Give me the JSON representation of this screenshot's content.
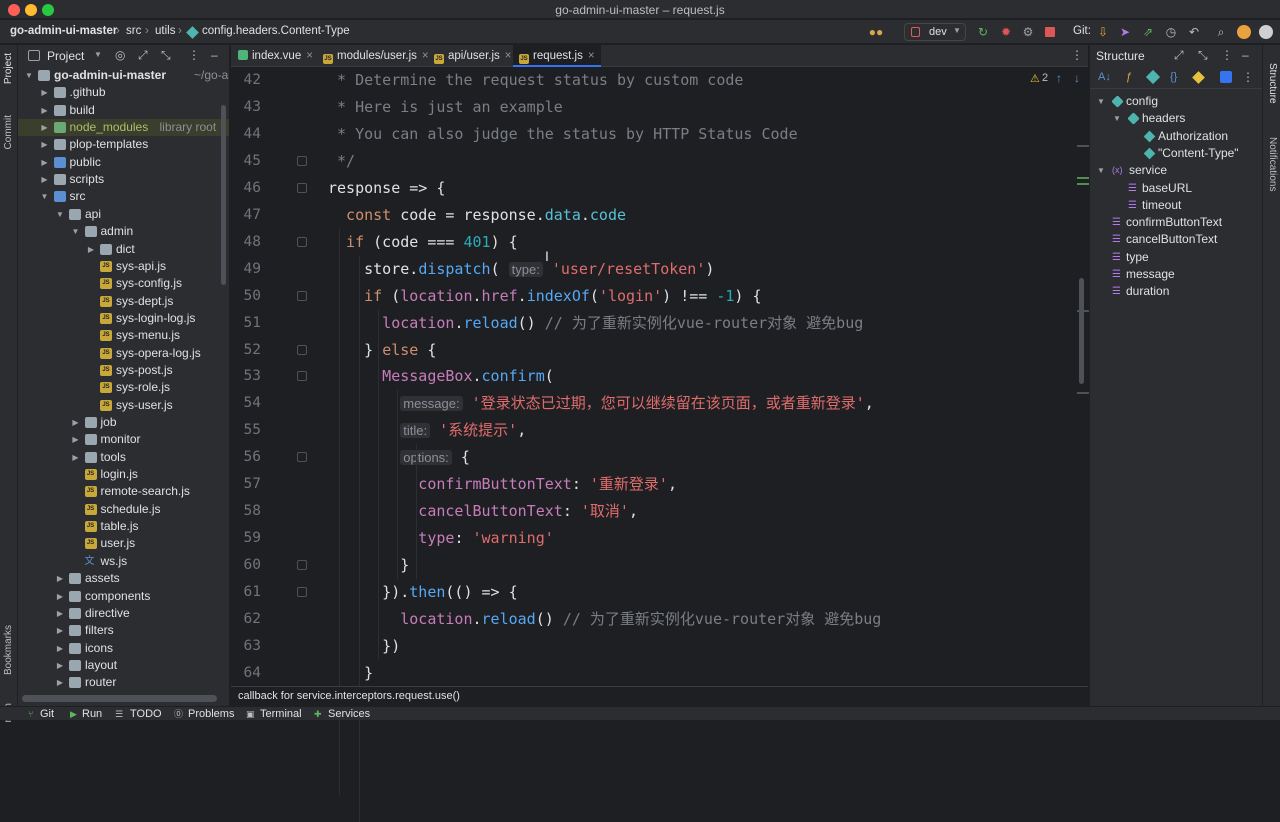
{
  "window": {
    "title": "go-admin-ui-master – request.js"
  },
  "breadcrumb": [
    "go-admin-ui-master",
    "src",
    "utils",
    "config.headers.Content-Type"
  ],
  "toolbar": {
    "branch": "dev",
    "git_label": "Git:"
  },
  "project_panel": {
    "title": "Project",
    "tree": [
      {
        "label": "go-admin-ui-master",
        "suffix": "~/go-adn",
        "depth": 0,
        "arrow": "down",
        "icon": "folder",
        "bold": true
      },
      {
        "label": ".github",
        "depth": 1,
        "arrow": "right",
        "icon": "folder"
      },
      {
        "label": "build",
        "depth": 1,
        "arrow": "right",
        "icon": "folder"
      },
      {
        "label": "node_modules",
        "suffix": "library root",
        "depth": 1,
        "arrow": "right",
        "icon": "folder-green",
        "highlight": true
      },
      {
        "label": "plop-templates",
        "depth": 1,
        "arrow": "right",
        "icon": "folder"
      },
      {
        "label": "public",
        "depth": 1,
        "arrow": "right",
        "icon": "folder-blue"
      },
      {
        "label": "scripts",
        "depth": 1,
        "arrow": "right",
        "icon": "folder"
      },
      {
        "label": "src",
        "depth": 1,
        "arrow": "down",
        "icon": "folder-blue"
      },
      {
        "label": "api",
        "depth": 2,
        "arrow": "down",
        "icon": "folder"
      },
      {
        "label": "admin",
        "depth": 3,
        "arrow": "down",
        "icon": "folder"
      },
      {
        "label": "dict",
        "depth": 4,
        "arrow": "right",
        "icon": "folder"
      },
      {
        "label": "sys-api.js",
        "depth": 4,
        "icon": "js"
      },
      {
        "label": "sys-config.js",
        "depth": 4,
        "icon": "js"
      },
      {
        "label": "sys-dept.js",
        "depth": 4,
        "icon": "js"
      },
      {
        "label": "sys-login-log.js",
        "depth": 4,
        "icon": "js"
      },
      {
        "label": "sys-menu.js",
        "depth": 4,
        "icon": "js"
      },
      {
        "label": "sys-opera-log.js",
        "depth": 4,
        "icon": "js"
      },
      {
        "label": "sys-post.js",
        "depth": 4,
        "icon": "js"
      },
      {
        "label": "sys-role.js",
        "depth": 4,
        "icon": "js"
      },
      {
        "label": "sys-user.js",
        "depth": 4,
        "icon": "js"
      },
      {
        "label": "job",
        "depth": 3,
        "arrow": "right",
        "icon": "folder"
      },
      {
        "label": "monitor",
        "depth": 3,
        "arrow": "right",
        "icon": "folder"
      },
      {
        "label": "tools",
        "depth": 3,
        "arrow": "right",
        "icon": "folder"
      },
      {
        "label": "login.js",
        "depth": 3,
        "icon": "js"
      },
      {
        "label": "remote-search.js",
        "depth": 3,
        "icon": "js"
      },
      {
        "label": "schedule.js",
        "depth": 3,
        "icon": "js"
      },
      {
        "label": "table.js",
        "depth": 3,
        "icon": "js"
      },
      {
        "label": "user.js",
        "depth": 3,
        "icon": "js"
      },
      {
        "label": "ws.js",
        "depth": 3,
        "icon": "ws"
      },
      {
        "label": "assets",
        "depth": 2,
        "arrow": "right",
        "icon": "folder"
      },
      {
        "label": "components",
        "depth": 2,
        "arrow": "right",
        "icon": "folder"
      },
      {
        "label": "directive",
        "depth": 2,
        "arrow": "right",
        "icon": "folder"
      },
      {
        "label": "filters",
        "depth": 2,
        "arrow": "right",
        "icon": "folder"
      },
      {
        "label": "icons",
        "depth": 2,
        "arrow": "right",
        "icon": "folder"
      },
      {
        "label": "layout",
        "depth": 2,
        "arrow": "right",
        "icon": "folder"
      },
      {
        "label": "router",
        "depth": 2,
        "arrow": "right",
        "icon": "folder"
      }
    ]
  },
  "editor": {
    "tabs": [
      {
        "label": "index.vue",
        "active": false
      },
      {
        "label": "modules/user.js",
        "active": false
      },
      {
        "label": "api/user.js",
        "active": false
      },
      {
        "label": "request.js",
        "active": true
      }
    ],
    "warnings_count": "2",
    "lines": [
      {
        "n": "42",
        "segs": [
          [
            "cm",
            " * Determine the request status by custom code"
          ]
        ]
      },
      {
        "n": "43",
        "segs": [
          [
            "cm",
            " * Here is just an example"
          ]
        ]
      },
      {
        "n": "44",
        "segs": [
          [
            "cm",
            " * You can also judge the status by HTTP Status Code"
          ]
        ]
      },
      {
        "n": "45",
        "segs": [
          [
            "cm",
            " */"
          ]
        ]
      },
      {
        "n": "46",
        "segs": [
          [
            "white",
            "response => {"
          ]
        ]
      },
      {
        "n": "47",
        "segs": [
          [
            "kw",
            "  const "
          ],
          [
            "white",
            "code = response."
          ],
          [
            "prop",
            "data"
          ],
          [
            "white",
            "."
          ],
          [
            "prop",
            "code"
          ]
        ]
      },
      {
        "n": "48",
        "segs": [
          [
            "kw",
            "  if "
          ],
          [
            "white",
            "(code === "
          ],
          [
            "num",
            "401"
          ],
          [
            "white",
            ") {"
          ]
        ]
      },
      {
        "n": "49",
        "segs": [
          [
            "white",
            "    store."
          ],
          [
            "fn",
            "dispatch"
          ],
          [
            "white",
            "( "
          ],
          [
            "hint",
            "type:"
          ],
          [
            "white",
            " "
          ],
          [
            "str",
            "'user/resetToken'"
          ],
          [
            "white",
            ")"
          ]
        ]
      },
      {
        "n": "50",
        "segs": [
          [
            "kw",
            "    if "
          ],
          [
            "white",
            "("
          ],
          [
            "memb",
            "location"
          ],
          [
            "white",
            "."
          ],
          [
            "memb",
            "href"
          ],
          [
            "white",
            "."
          ],
          [
            "fn",
            "indexOf"
          ],
          [
            "white",
            "("
          ],
          [
            "str",
            "'login'"
          ],
          [
            "white",
            ") !== "
          ],
          [
            "num",
            "-1"
          ],
          [
            "white",
            ") {"
          ]
        ]
      },
      {
        "n": "51",
        "segs": [
          [
            "memb",
            "      location"
          ],
          [
            "white",
            "."
          ],
          [
            "fn",
            "reload"
          ],
          [
            "white",
            "() "
          ],
          [
            "cm",
            "// 为了重新实例化vue-router对象 避免bug"
          ]
        ]
      },
      {
        "n": "52",
        "segs": [
          [
            "white",
            "    } "
          ],
          [
            "kw",
            "else "
          ],
          [
            "white",
            "{"
          ]
        ]
      },
      {
        "n": "53",
        "segs": [
          [
            "memb",
            "      MessageBox"
          ],
          [
            "white",
            "."
          ],
          [
            "fn",
            "confirm"
          ],
          [
            "white",
            "("
          ]
        ]
      },
      {
        "n": "54",
        "segs": [
          [
            "white",
            "        "
          ],
          [
            "hint",
            "message:"
          ],
          [
            "white",
            " "
          ],
          [
            "str",
            "'登录状态已过期，您可以继续留在该页面，或者重新登录'"
          ],
          [
            "white",
            ","
          ]
        ]
      },
      {
        "n": "55",
        "segs": [
          [
            "white",
            "        "
          ],
          [
            "hint",
            "title:"
          ],
          [
            "white",
            " "
          ],
          [
            "str",
            "'系统提示'"
          ],
          [
            "white",
            ","
          ]
        ]
      },
      {
        "n": "56",
        "segs": [
          [
            "white",
            "        "
          ],
          [
            "hint",
            "options:"
          ],
          [
            "white",
            " {"
          ]
        ]
      },
      {
        "n": "57",
        "segs": [
          [
            "key",
            "          confirmButtonText"
          ],
          [
            "white",
            ": "
          ],
          [
            "str",
            "'重新登录'"
          ],
          [
            "white",
            ","
          ]
        ]
      },
      {
        "n": "58",
        "segs": [
          [
            "key",
            "          cancelButtonText"
          ],
          [
            "white",
            ": "
          ],
          [
            "str",
            "'取消'"
          ],
          [
            "white",
            ","
          ]
        ]
      },
      {
        "n": "59",
        "segs": [
          [
            "key",
            "          type"
          ],
          [
            "white",
            ": "
          ],
          [
            "str",
            "'warning'"
          ]
        ]
      },
      {
        "n": "60",
        "segs": [
          [
            "white",
            "        }"
          ]
        ]
      },
      {
        "n": "61",
        "segs": [
          [
            "white",
            "      })."
          ],
          [
            "fn",
            "then"
          ],
          [
            "white",
            "(() => {"
          ]
        ]
      },
      {
        "n": "62",
        "segs": [
          [
            "memb",
            "        location"
          ],
          [
            "white",
            "."
          ],
          [
            "fn",
            "reload"
          ],
          [
            "white",
            "() "
          ],
          [
            "cm",
            "// 为了重新实例化vue-router对象 避免bug"
          ]
        ]
      },
      {
        "n": "63",
        "segs": [
          [
            "white",
            "      })"
          ]
        ]
      },
      {
        "n": "64",
        "segs": [
          [
            "white",
            "    }"
          ]
        ]
      }
    ],
    "hint_bar": "callback for service.interceptors.request.use()"
  },
  "structure_panel": {
    "title": "Structure",
    "tree": [
      {
        "label": "config",
        "depth": 0,
        "arrow": "down",
        "icon": "cube"
      },
      {
        "label": "headers",
        "depth": 1,
        "arrow": "down",
        "icon": "cube"
      },
      {
        "label": "Authorization",
        "depth": 2,
        "icon": "prop-green"
      },
      {
        "label": "\"Content-Type\"",
        "depth": 2,
        "icon": "prop-green"
      },
      {
        "label": "service",
        "depth": 0,
        "arrow": "down",
        "icon": "var"
      },
      {
        "label": "baseURL",
        "depth": 1,
        "icon": "field"
      },
      {
        "label": "timeout",
        "depth": 1,
        "icon": "field"
      },
      {
        "label": "confirmButtonText",
        "depth": 0,
        "icon": "field"
      },
      {
        "label": "cancelButtonText",
        "depth": 0,
        "icon": "field"
      },
      {
        "label": "type",
        "depth": 0,
        "icon": "field"
      },
      {
        "label": "message",
        "depth": 0,
        "icon": "field"
      },
      {
        "label": "duration",
        "depth": 0,
        "icon": "field"
      }
    ]
  },
  "side_tools": {
    "left_top": [
      "Project",
      "Commit"
    ],
    "left_bottom": [
      "Bookmarks",
      "npm"
    ],
    "right": [
      "Structure",
      "Notifications"
    ]
  },
  "status_bar": {
    "items": [
      "Git",
      "Run",
      "TODO",
      "Problems",
      "Terminal",
      "Services"
    ]
  }
}
